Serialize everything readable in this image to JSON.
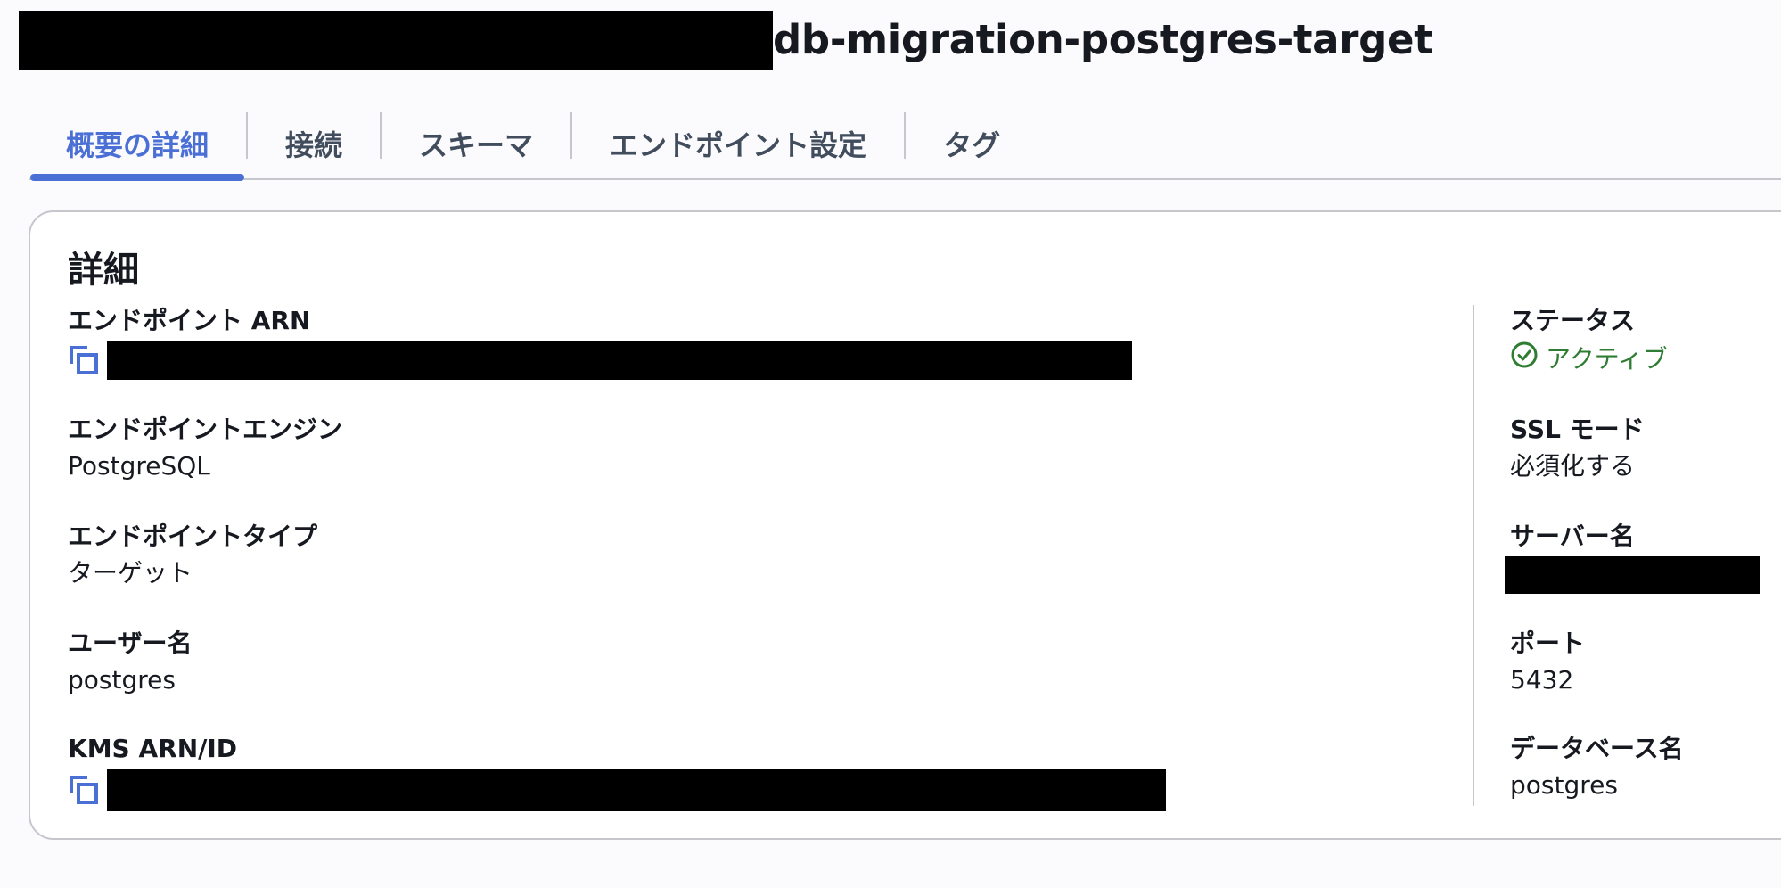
{
  "header": {
    "title": "db-migration-postgres-target"
  },
  "tabs": [
    {
      "label": "概要の詳細",
      "active": true
    },
    {
      "label": "接続",
      "active": false
    },
    {
      "label": "スキーマ",
      "active": false
    },
    {
      "label": "エンドポイント設定",
      "active": false
    },
    {
      "label": "タグ",
      "active": false
    }
  ],
  "details": {
    "heading": "詳細",
    "left": {
      "endpoint_arn": {
        "label": "エンドポイント ARN",
        "value": ""
      },
      "endpoint_engine": {
        "label": "エンドポイントエンジン",
        "value": "PostgreSQL"
      },
      "endpoint_type": {
        "label": "エンドポイントタイプ",
        "value": "ターゲット"
      },
      "username": {
        "label": "ユーザー名",
        "value": "postgres"
      },
      "kms_arn": {
        "label": "KMS ARN/ID",
        "value": ""
      }
    },
    "right": {
      "status": {
        "label": "ステータス",
        "value": "アクティブ",
        "color": "#2e7d32"
      },
      "ssl_mode": {
        "label": "SSL モード",
        "value": "必須化する"
      },
      "server_name": {
        "label": "サーバー名",
        "value": ""
      },
      "port": {
        "label": "ポート",
        "value": "5432"
      },
      "database_name": {
        "label": "データベース名",
        "value": "postgres"
      }
    }
  },
  "colors": {
    "accent": "#4a6fd5",
    "success": "#2e7d32",
    "border": "#c6c6cd"
  },
  "icons": {
    "copy": "copy-icon",
    "status": "check-circle-icon"
  }
}
